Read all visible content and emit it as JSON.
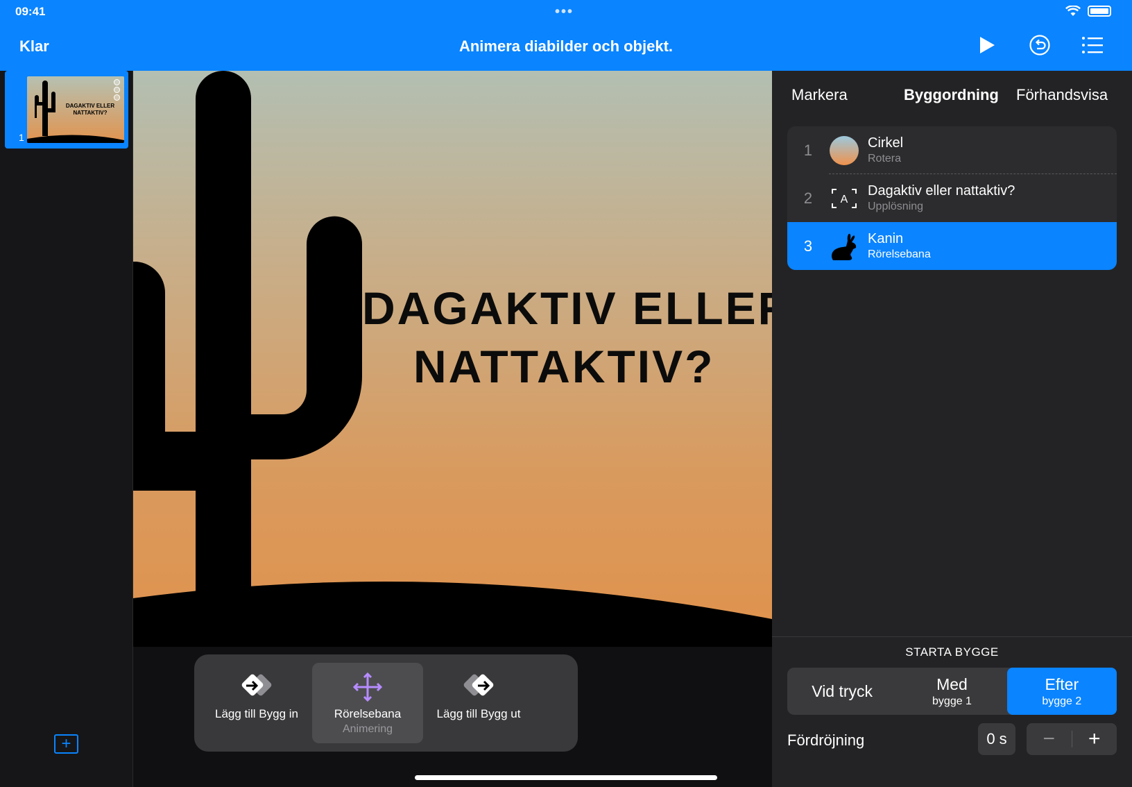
{
  "status": {
    "time": "09:41",
    "dots": "•••"
  },
  "nav": {
    "done_label": "Klar",
    "title": "Animera diabilder och objekt."
  },
  "navigator": {
    "slide_number": "1",
    "thumb_title_line1": "DAGAKTIV ELLER",
    "thumb_title_line2": "NATTAKTIV?",
    "add_label": "+"
  },
  "slide": {
    "title_line1": "DAGAKTIV ELLER",
    "title_line2": "NATTAKTIV?"
  },
  "popup": {
    "items": [
      {
        "label": "Lägg till Bygg in",
        "sub": ""
      },
      {
        "label": "Rörelsebana",
        "sub": "Animering"
      },
      {
        "label": "Lägg till Bygg ut",
        "sub": ""
      }
    ]
  },
  "panel": {
    "tabs": [
      "Markera",
      "Byggordning",
      "Förhandsvisa"
    ],
    "builds": [
      {
        "num": "1",
        "name": "Cirkel",
        "effect": "Rotera",
        "icon": "circle-icon"
      },
      {
        "num": "2",
        "name": "Dagaktiv eller nattaktiv?",
        "effect": "Upplösning",
        "icon": "text-box-icon"
      },
      {
        "num": "3",
        "name": "Kanin",
        "effect": "Rörelsebana",
        "icon": "rabbit-icon"
      }
    ],
    "start_label": "STARTA BYGGE",
    "segments": [
      {
        "title": "Vid tryck",
        "sub": ""
      },
      {
        "title": "Med",
        "sub": "bygge 1"
      },
      {
        "title": "Efter",
        "sub": "bygge 2"
      }
    ],
    "delay_label": "Fördröjning",
    "delay_value": "0 s",
    "stepper_minus": "−",
    "stepper_plus": "+"
  },
  "colors": {
    "accent": "#0a84ff",
    "panel_bg": "#232325",
    "motion_purple": "#b78cff"
  }
}
